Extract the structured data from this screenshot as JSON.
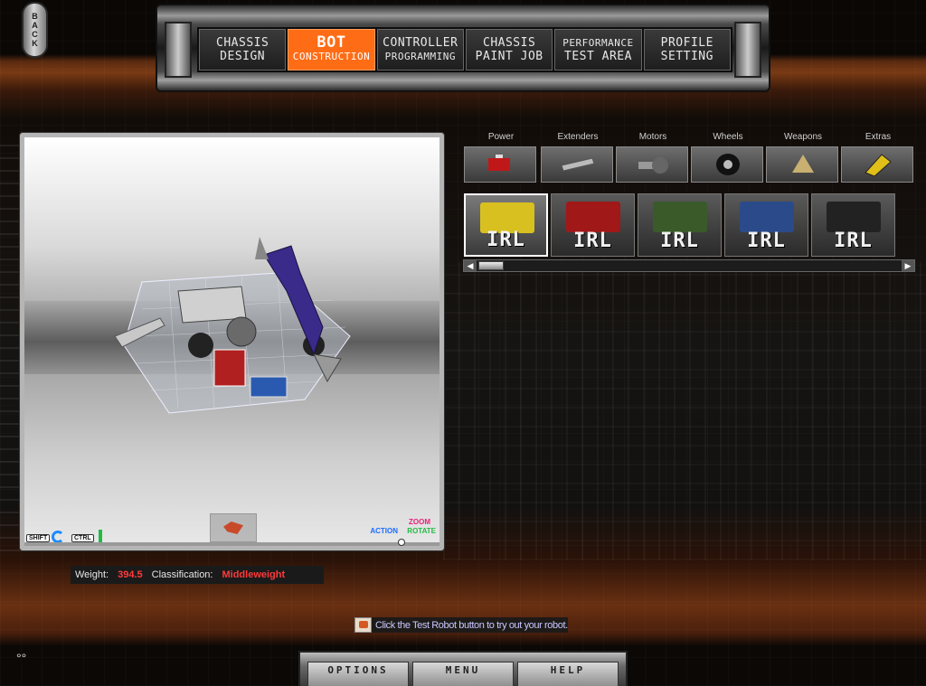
{
  "back_button": {
    "label": "BACK"
  },
  "nav_tabs": [
    {
      "line1": "CHASSIS",
      "line2": "DESIGN",
      "active": false
    },
    {
      "line1": "BOT",
      "line2": "CONSTRUCTION",
      "active": true
    },
    {
      "line1": "CONTROLLER",
      "line2": "PROGRAMMING",
      "active": false
    },
    {
      "line1": "CHASSIS",
      "line2": "PAINT JOB",
      "active": false
    },
    {
      "line1": "PERFORMANCE",
      "line2": "TEST AREA",
      "active": false
    },
    {
      "line1": "PROFILE",
      "line2": "SETTING",
      "active": false
    }
  ],
  "viewport": {
    "shift_key": "SHIFT",
    "ctrl_key": "CTRL",
    "zoom_label": "ZOOM",
    "action_label": "ACTION",
    "rotate_label": "ROTATE"
  },
  "status": {
    "weight_label": "Weight:",
    "weight_value": "394.5",
    "class_label": "Classification:",
    "class_value": "Middleweight"
  },
  "categories": [
    {
      "label": "Power",
      "icon": "battery-icon"
    },
    {
      "label": "Extenders",
      "icon": "extender-bar-icon"
    },
    {
      "label": "Motors",
      "icon": "motor-icon"
    },
    {
      "label": "Wheels",
      "icon": "wheel-icon"
    },
    {
      "label": "Weapons",
      "icon": "weapon-icon"
    },
    {
      "label": "Extras",
      "icon": "extras-icon"
    }
  ],
  "parts": [
    {
      "label": "IRL",
      "color": "#d8c020",
      "active": true
    },
    {
      "label": "IRL",
      "color": "#a01818",
      "active": false
    },
    {
      "label": "IRL",
      "color": "#3a5a2a",
      "active": false
    },
    {
      "label": "IRL",
      "color": "#2a4a8a",
      "active": false
    },
    {
      "label": "IRL",
      "color": "#222222",
      "active": false
    }
  ],
  "hint": {
    "text": "Click the Test Robot button to try out your robot."
  },
  "bottom_menu": [
    "OPTIONS",
    "MENU",
    "HELP"
  ]
}
